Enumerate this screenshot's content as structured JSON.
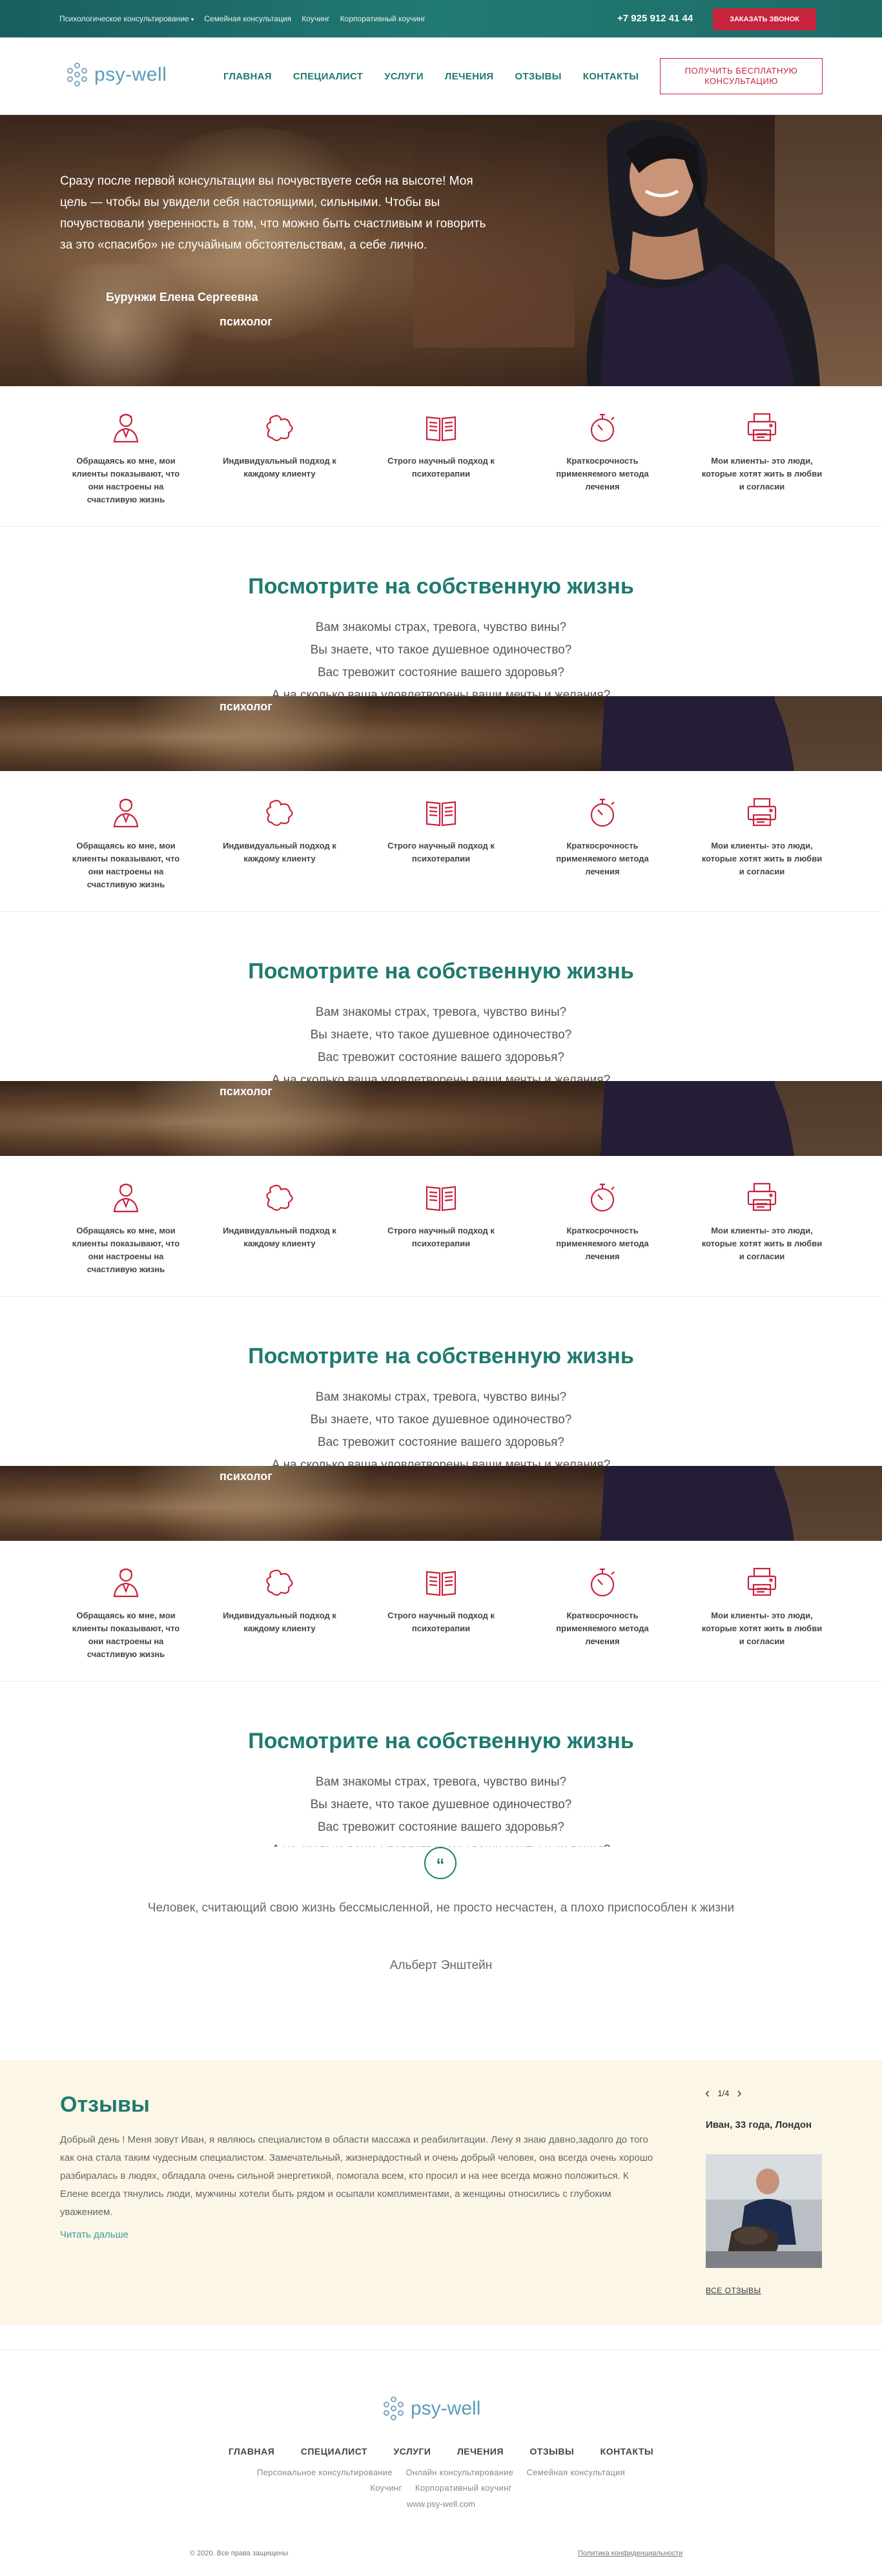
{
  "topbar": {
    "links": [
      "Психологическое консультирование",
      "Семейная консультация",
      "Коучинг",
      "Корпоративный коучинг"
    ],
    "phone": "+7 925 912 41 44",
    "callback": "ЗАКАЗАТЬ ЗВОНОК"
  },
  "header": {
    "logo": "psy-well",
    "nav": [
      "ГЛАВНАЯ",
      "СПЕЦИАЛИСТ",
      "УСЛУГИ",
      "ЛЕЧЕНИЯ",
      "ОТЗЫВЫ",
      "КОНТАКТЫ"
    ],
    "cta": "ПОЛУЧИТЬ БЕСПЛАТНУЮ КОНСУЛЬТАЦИЮ"
  },
  "hero": {
    "quote": "Сразу после первой консультации вы почувствуете себя на высоте! Моя цель — чтобы вы увидели себя настоящими, сильными. Чтобы вы почувствовали уверенность в том, что можно быть счастливым и говорить за это «спасибо» не случайным обстоятельствам, а себе лично.",
    "author": "Бурунжи Елена Сергеевна",
    "role": "психолог"
  },
  "features": [
    {
      "icon": "person-icon",
      "text": "Обращаясь ко мне, мои клиенты показывают, что они настроены на счастливую жизнь"
    },
    {
      "icon": "puzzle-icon",
      "text": "Индивидуальный подход к каждому клиенту"
    },
    {
      "icon": "book-icon",
      "text": "Строго научный подход к психотерапии"
    },
    {
      "icon": "stopwatch-icon",
      "text": "Краткосрочность применяемого метода лечения"
    },
    {
      "icon": "printer-icon",
      "text": "Мои клиенты- это люди, которые хотят жить в любви и согласии"
    }
  ],
  "lookup": {
    "title": "Посмотрите на собственную жизнь",
    "questions": [
      "Вам знакомы страх, тревога, чувство вины?",
      "Вы знаете, что такое душевное одиночество?",
      "Вас тревожит состояние вашего здоровья?",
      "А на сколько ваша удовлетворены ваши мечты и желания?"
    ]
  },
  "citation": {
    "mark": "“",
    "text": "Человек, считающий свою жизнь бессмысленной, не просто несчастен, а плохо приспособлен к жизни",
    "author": "Альберт Энштейн"
  },
  "reviews": {
    "title": "Отзывы",
    "body": "Добрый день ! Меня зовут Иван, я являюсь специалистом в области массажа и реабилитации. Лену я знаю давно,задолго до того как она стала таким чудесным специалистом. Замечательный, жизнерадостный и очень добрый человек, она всегда очень хорошо разбиралась в людях, обладала очень сильной энергетикой, помогала всем, кто просил и на нее всегда можно положиться. К Елене всегда тянулись люди, мужчины хотели быть рядом и осыпали комплиментами, а женщины относились с глубоким уважением.",
    "more": "Читать дальше",
    "pager": "1/4",
    "reviewer": "Иван, 33 года, Лондон",
    "all": "ВСЕ ОТЗЫВЫ"
  },
  "footer": {
    "logo": "psy-well",
    "nav": [
      "ГЛАВНАЯ",
      "СПЕЦИАЛИСТ",
      "УСЛУГИ",
      "ЛЕЧЕНИЯ",
      "ОТЗЫВЫ",
      "КОНТАКТЫ"
    ],
    "sub1": [
      "Персональное консультирование",
      "Онлайн консультирование",
      "Семейная консультация"
    ],
    "sub2": [
      "Коучинг",
      "Корпоративный коучинг"
    ],
    "site": "www.psy-well.com",
    "copyright": "© 2020. Все права защищены",
    "privacy": "Политика конфиденциальности"
  },
  "colors": {
    "brand": "#1f7a6f",
    "accent": "#c8233d",
    "reviews_bg": "#fcf6e6"
  }
}
